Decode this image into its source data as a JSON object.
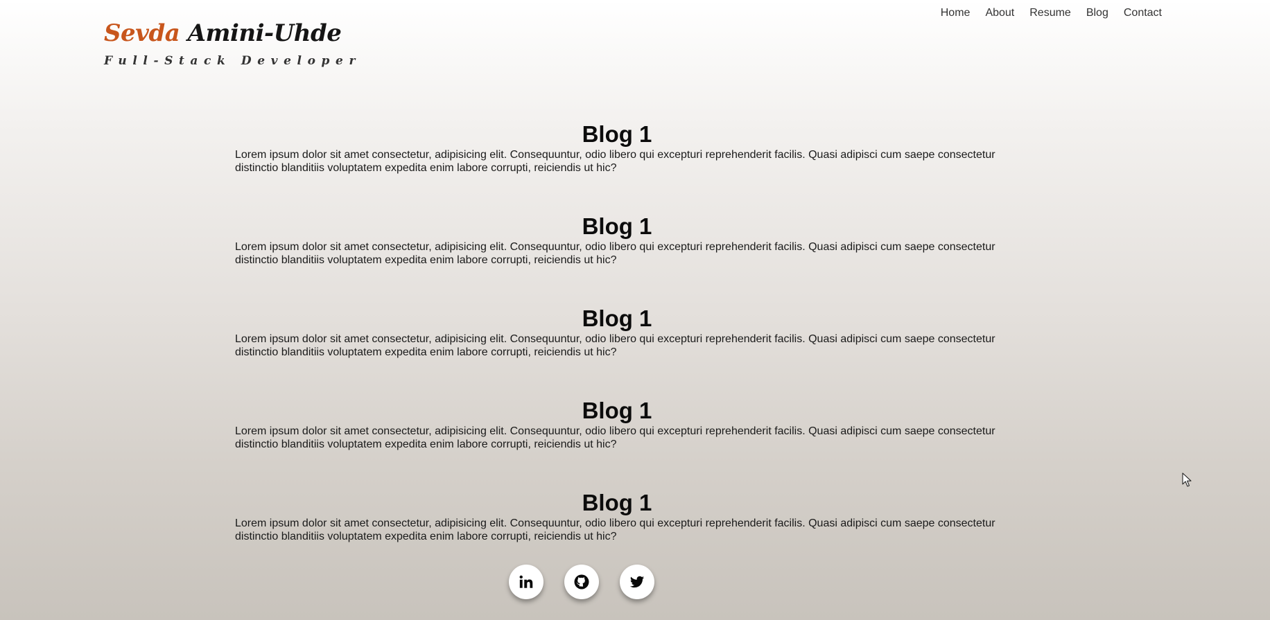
{
  "header": {
    "brand_first": "Sevda",
    "brand_last": "Amini-Uhde",
    "brand_subtitle": "Full-Stack Developer"
  },
  "nav": {
    "items": [
      {
        "label": "Home"
      },
      {
        "label": "About"
      },
      {
        "label": "Resume"
      },
      {
        "label": "Blog"
      },
      {
        "label": "Contact"
      }
    ]
  },
  "posts": [
    {
      "title": "Blog 1",
      "body": "Lorem ipsum dolor sit amet consectetur, adipisicing elit. Consequuntur, odio libero qui excepturi reprehenderit facilis. Quasi adipisci cum saepe consectetur distinctio blanditiis voluptatem expedita enim labore corrupti, reiciendis ut hic?"
    },
    {
      "title": "Blog 1",
      "body": "Lorem ipsum dolor sit amet consectetur, adipisicing elit. Consequuntur, odio libero qui excepturi reprehenderit facilis. Quasi adipisci cum saepe consectetur distinctio blanditiis voluptatem expedita enim labore corrupti, reiciendis ut hic?"
    },
    {
      "title": "Blog 1",
      "body": "Lorem ipsum dolor sit amet consectetur, adipisicing elit. Consequuntur, odio libero qui excepturi reprehenderit facilis. Quasi adipisci cum saepe consectetur distinctio blanditiis voluptatem expedita enim labore corrupti, reiciendis ut hic?"
    },
    {
      "title": "Blog 1",
      "body": "Lorem ipsum dolor sit amet consectetur, adipisicing elit. Consequuntur, odio libero qui excepturi reprehenderit facilis. Quasi adipisci cum saepe consectetur distinctio blanditiis voluptatem expedita enim labore corrupti, reiciendis ut hic?"
    },
    {
      "title": "Blog 1",
      "body": "Lorem ipsum dolor sit amet consectetur, adipisicing elit. Consequuntur, odio libero qui excepturi reprehenderit facilis. Quasi adipisci cum saepe consectetur distinctio blanditiis voluptatem expedita enim labore corrupti, reiciendis ut hic?"
    }
  ],
  "social": {
    "items": [
      {
        "icon": "linkedin-icon"
      },
      {
        "icon": "github-icon"
      },
      {
        "icon": "twitter-icon"
      }
    ]
  },
  "colors": {
    "accent": "#c8561c",
    "text": "#151515",
    "background_top": "#ffffff",
    "background_bottom": "#c8c3bc"
  }
}
